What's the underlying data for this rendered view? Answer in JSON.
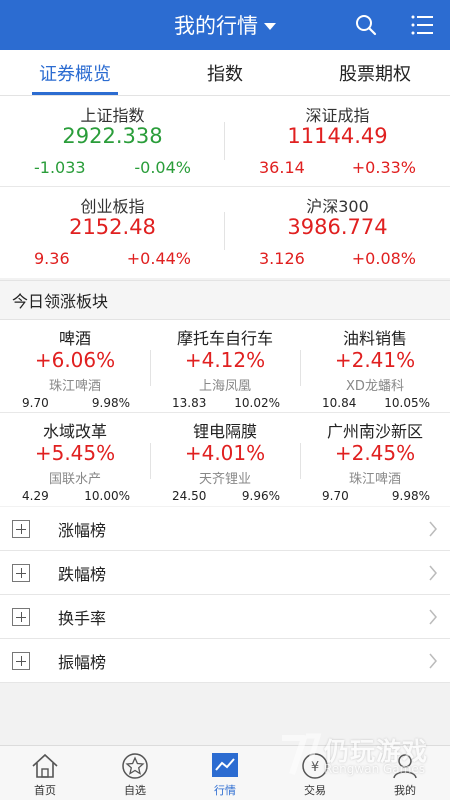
{
  "header": {
    "title": "我的行情",
    "accent_color": "#2c6cd1",
    "search_icon": "search-icon",
    "menu_icon": "list-menu-icon"
  },
  "tabs": [
    {
      "label": "证券概览",
      "active": true
    },
    {
      "label": "指数",
      "active": false
    },
    {
      "label": "股票期权",
      "active": false
    }
  ],
  "indices": [
    {
      "name": "上证指数",
      "value": "2922.338",
      "change": "-1.033",
      "pct": "-0.04%",
      "trend": "down"
    },
    {
      "name": "深证成指",
      "value": "11144.49",
      "change": "36.14",
      "pct": "+0.33%",
      "trend": "up"
    },
    {
      "name": "创业板指",
      "value": "2152.48",
      "change": "9.36",
      "pct": "+0.44%",
      "trend": "up"
    },
    {
      "name": "沪深300",
      "value": "3986.774",
      "change": "3.126",
      "pct": "+0.08%",
      "trend": "up"
    }
  ],
  "sectors_title": "今日领涨板块",
  "sectors": [
    {
      "name": "啤酒",
      "pct": "+6.06%",
      "stock": "珠江啤酒",
      "price": "9.70",
      "stock_pct": "9.98%"
    },
    {
      "name": "摩托车自行车",
      "pct": "+4.12%",
      "stock": "上海凤凰",
      "price": "13.83",
      "stock_pct": "10.02%"
    },
    {
      "name": "油料销售",
      "pct": "+2.41%",
      "stock": "XD龙蟠科",
      "price": "10.84",
      "stock_pct": "10.05%"
    },
    {
      "name": "水域改革",
      "pct": "+5.45%",
      "stock": "国联水产",
      "price": "4.29",
      "stock_pct": "10.00%"
    },
    {
      "name": "锂电隔膜",
      "pct": "+4.01%",
      "stock": "天齐锂业",
      "price": "24.50",
      "stock_pct": "9.96%"
    },
    {
      "name": "广州南沙新区",
      "pct": "+2.45%",
      "stock": "珠江啤酒",
      "price": "9.70",
      "stock_pct": "9.98%"
    }
  ],
  "rankings": [
    {
      "label": "涨幅榜"
    },
    {
      "label": "跌幅榜"
    },
    {
      "label": "换手率"
    },
    {
      "label": "振幅榜"
    }
  ],
  "bottom_nav": [
    {
      "label": "首页",
      "icon": "home-icon",
      "active": false
    },
    {
      "label": "自选",
      "icon": "star-icon",
      "active": false
    },
    {
      "label": "行情",
      "icon": "chart-icon",
      "active": true
    },
    {
      "label": "交易",
      "icon": "trade-icon",
      "active": false
    },
    {
      "label": "我的",
      "icon": "user-icon",
      "active": false
    }
  ],
  "watermark": {
    "text": "仍玩游戏",
    "sub": "Rengwan Games"
  },
  "colors": {
    "up": "#e02020",
    "down": "#2a9d3a"
  }
}
